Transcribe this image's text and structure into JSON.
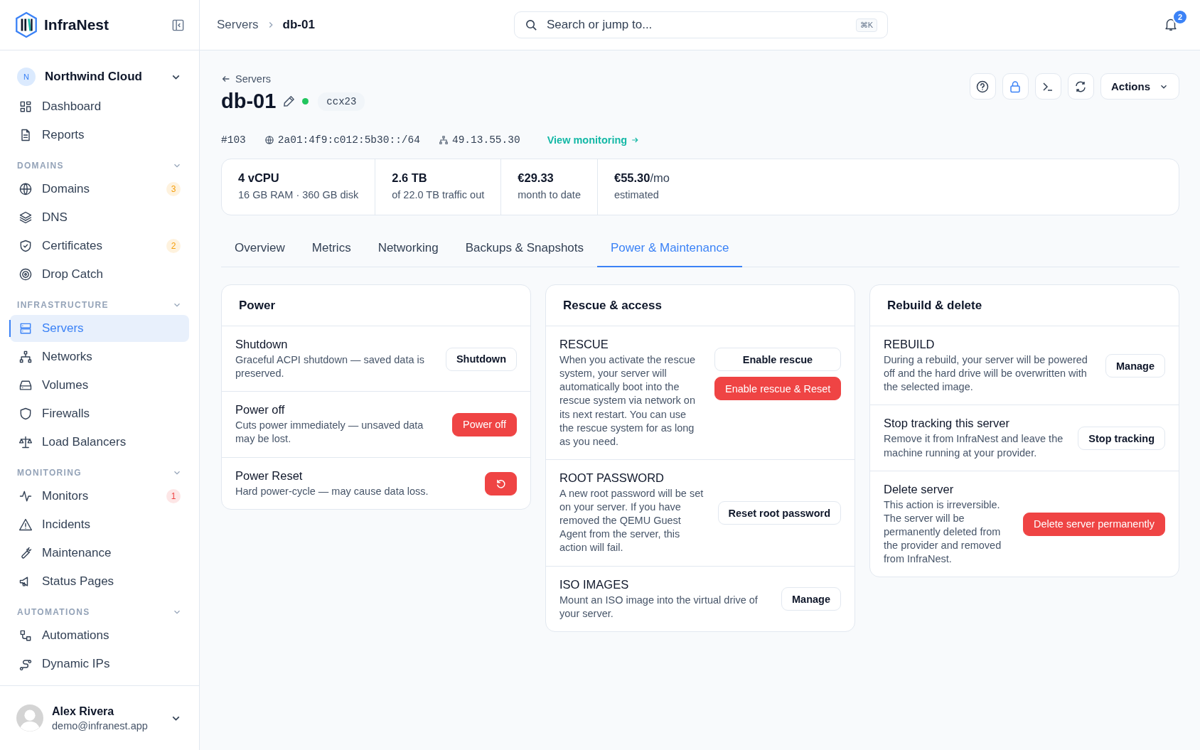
{
  "brand": {
    "name": "InfraNest"
  },
  "workspace": {
    "initial": "N",
    "name": "Northwind Cloud"
  },
  "nav_sections": [
    {
      "items": [
        {
          "label": "Dashboard",
          "selected": false
        },
        {
          "label": "Reports",
          "selected": false
        }
      ]
    },
    {
      "label": "DOMAINS",
      "items": [
        {
          "label": "Domains",
          "selected": false,
          "badge": "3",
          "color": "#f59e0b"
        },
        {
          "label": "DNS",
          "selected": false
        },
        {
          "label": "Certificates",
          "selected": false,
          "badge": "2",
          "color": "#f59e0b"
        },
        {
          "label": "Drop Catch",
          "selected": false
        }
      ]
    },
    {
      "label": "INFRASTRUCTURE",
      "items": [
        {
          "label": "Servers",
          "selected": true
        },
        {
          "label": "Networks",
          "selected": false
        },
        {
          "label": "Volumes",
          "selected": false
        },
        {
          "label": "Firewalls",
          "selected": false
        },
        {
          "label": "Load Balancers",
          "selected": false
        }
      ]
    },
    {
      "label": "MONITORING",
      "items": [
        {
          "label": "Monitors",
          "selected": false,
          "badge": "1",
          "color": "#ef4444"
        },
        {
          "label": "Incidents",
          "selected": false
        },
        {
          "label": "Maintenance",
          "selected": false
        },
        {
          "label": "Status Pages",
          "selected": false
        }
      ]
    },
    {
      "label": "AUTOMATIONS",
      "items": [
        {
          "label": "Automations",
          "selected": false
        },
        {
          "label": "Dynamic IPs",
          "selected": false
        }
      ]
    }
  ],
  "user": {
    "name": "Alex Rivera",
    "email": "demo@infranest.app"
  },
  "breadcrumb": [
    "Servers",
    "db-01"
  ],
  "search": {
    "placeholder": "Search or jump to...",
    "shortcut": "⌘K"
  },
  "notifications": {
    "count": "2"
  },
  "server": {
    "back": "Servers",
    "name": "db-01",
    "online": true,
    "plan": "ccx23",
    "id": "#103",
    "ipv6": "2a01:4f9:c012:5b30::/64",
    "ipv4": "49.13.55.30",
    "monitoring_link": "View monitoring"
  },
  "actions_menu": "Actions",
  "stats": [
    {
      "value": "4 vCPU",
      "caption": "16 GB RAM · 360 GB disk"
    },
    {
      "value": "2.6 TB",
      "caption": "of 22.0 TB traffic out"
    },
    {
      "value": "€29.33",
      "caption": "month to date"
    },
    {
      "value": "€55.30",
      "unit": "/mo",
      "caption": "estimated"
    }
  ],
  "tabs": [
    {
      "label": "Overview",
      "selected": false
    },
    {
      "label": "Metrics",
      "selected": false
    },
    {
      "label": "Networking",
      "selected": false
    },
    {
      "label": "Backups & Snapshots",
      "selected": false
    },
    {
      "label": "Power & Maintenance",
      "selected": true
    }
  ],
  "panels": [
    {
      "title": "Power",
      "rows": [
        {
          "title": "Shutdown",
          "description": "Graceful ACPI shutdown — saved data is preserved.",
          "actions": [
            {
              "kind": "outline",
              "label": "Shutdown"
            }
          ]
        },
        {
          "title": "Power off",
          "description": "Cuts power immediately — unsaved data may be lost.",
          "actions": [
            {
              "kind": "danger",
              "label": "Power off"
            }
          ]
        },
        {
          "title": "Power Reset",
          "description": "Hard power-cycle — may cause data loss.",
          "actions": [
            {
              "kind": "danger-icon"
            }
          ]
        }
      ]
    },
    {
      "title": "Rescue & access",
      "rows": [
        {
          "title": "RESCUE",
          "description": "When you activate the rescue system, your server will automatically boot into the rescue system via network on its next restart. You can use the rescue system for as long as you need.",
          "actions": [
            {
              "kind": "outline",
              "label": "Enable rescue"
            },
            {
              "kind": "danger",
              "label": "Enable rescue & Reset"
            }
          ]
        },
        {
          "title": "ROOT PASSWORD",
          "description": "A new root password will be set on your server. If you have removed the QEMU Guest Agent from the server, this action will fail.",
          "actions": [
            {
              "kind": "outline",
              "label": "Reset root password"
            }
          ]
        },
        {
          "title": "ISO IMAGES",
          "description": "Mount an ISO image into the virtual drive of your server.",
          "actions": [
            {
              "kind": "outline",
              "label": "Manage"
            }
          ]
        }
      ]
    },
    {
      "title": "Rebuild & delete",
      "rows": [
        {
          "title": "REBUILD",
          "description": "During a rebuild, your server will be powered off and the hard drive will be overwritten with the selected image.",
          "actions": [
            {
              "kind": "outline",
              "label": "Manage"
            }
          ]
        },
        {
          "title": "Stop tracking this server",
          "description": "Remove it from InfraNest and leave the machine running at your provider.",
          "actions": [
            {
              "kind": "outline",
              "label": "Stop tracking"
            }
          ]
        },
        {
          "title": "Delete server",
          "description": "This action is irreversible. The server will be permanently deleted from the provider and removed from InfraNest.",
          "actions": [
            {
              "kind": "danger",
              "label": "Delete server permanently"
            }
          ]
        }
      ]
    }
  ]
}
